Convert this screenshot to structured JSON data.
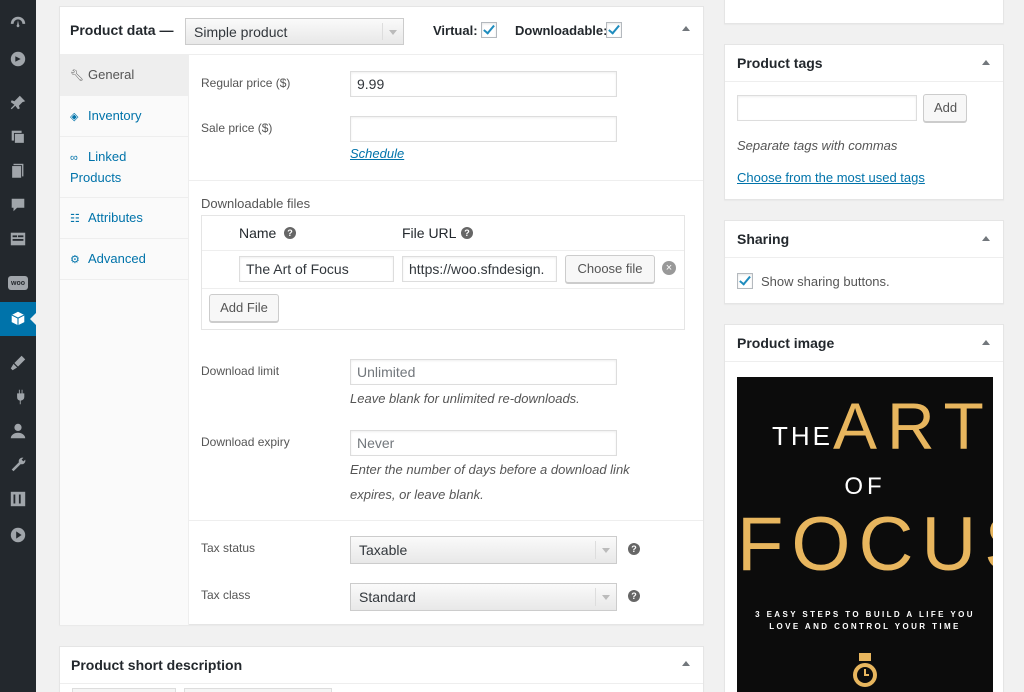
{
  "sidebar": {
    "icons": [
      "dashboard-icon",
      "updates-icon",
      "posts-pin-icon",
      "media-icon",
      "pages-icon",
      "comments-icon",
      "forms-icon",
      "woocommerce-icon",
      "products-icon",
      "appearance-icon",
      "plugins-icon",
      "users-icon",
      "tools-icon",
      "settings-icon",
      "media-play-icon"
    ],
    "woo_label": "woo",
    "active": "products-icon"
  },
  "product_data": {
    "title": "Product data —",
    "product_type": "Simple product",
    "virtual_label": "Virtual:",
    "virtual_checked": true,
    "downloadable_label": "Downloadable:",
    "downloadable_checked": true,
    "tabs": [
      {
        "label": "General",
        "icon": "wrench-icon",
        "active": true
      },
      {
        "label": "Inventory",
        "icon": "tag-icon",
        "active": false
      },
      {
        "label": "Linked",
        "label2": "Products",
        "icon": "link-icon",
        "active": false
      },
      {
        "label": "Attributes",
        "icon": "list-icon",
        "active": false
      },
      {
        "label": "Advanced",
        "icon": "gear-icon",
        "active": false
      }
    ],
    "regular_price_label": "Regular price ($)",
    "regular_price_value": "9.99",
    "sale_price_label": "Sale price ($)",
    "sale_price_value": "",
    "schedule_link": "Schedule",
    "downloadable_files_label": "Downloadable files",
    "files_table": {
      "name_header": "Name",
      "url_header": "File URL",
      "rows": [
        {
          "name": "The Art of Focus",
          "url": "https://woo.sfndesign."
        }
      ],
      "choose_file_label": "Choose file",
      "add_file_label": "Add File"
    },
    "download_limit_label": "Download limit",
    "download_limit_placeholder": "Unlimited",
    "download_limit_help": "Leave blank for unlimited re-downloads.",
    "download_expiry_label": "Download expiry",
    "download_expiry_placeholder": "Never",
    "download_expiry_help_1": "Enter the number of days before a download link",
    "download_expiry_help_2": "expires, or leave blank.",
    "tax_status_label": "Tax status",
    "tax_status_value": "Taxable",
    "tax_class_label": "Tax class",
    "tax_class_value": "Standard"
  },
  "short_description": {
    "title": "Product short description"
  },
  "product_tags": {
    "title": "Product tags",
    "input_value": "",
    "add_label": "Add",
    "help": "Separate tags with commas",
    "most_used_link": "Choose from the most used tags"
  },
  "sharing": {
    "title": "Sharing",
    "show_label": "Show sharing buttons.",
    "show_checked": true
  },
  "product_image": {
    "title": "Product image",
    "cover": {
      "the": "THE",
      "art": "ART",
      "of": "OF",
      "focus": "FOCUS",
      "subtitle_1": "3 EASY STEPS TO BUILD A LIFE YOU",
      "subtitle_2": "LOVE AND CONTROL YOUR TIME"
    }
  },
  "colors": {
    "admin_bar": "#23282d",
    "accent": "#0073aa",
    "cover_gold": "#e8b65e"
  }
}
